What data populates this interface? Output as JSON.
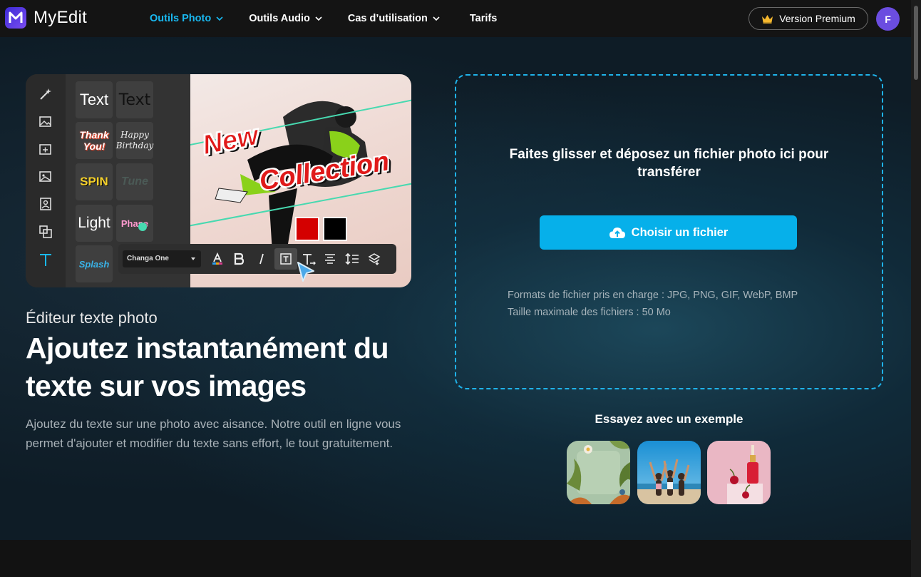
{
  "header": {
    "logo_text": "MyEdit",
    "nav": [
      {
        "label": "Outils Photo",
        "active": true
      },
      {
        "label": "Outils Audio"
      },
      {
        "label": "Cas d’utilisation"
      },
      {
        "label": "Tarifs"
      }
    ],
    "premium_label": "Version Premium",
    "avatar_initial": "F"
  },
  "preview": {
    "tiles": [
      "Text",
      "Text",
      "Thank You!",
      "Happy Birthday",
      "SPIN",
      "Tune",
      "Light",
      "Phase",
      "Splash"
    ],
    "font_select": "Changa One",
    "overlay_line1": "New",
    "overlay_line2": "Collection",
    "swatch_colors": [
      "#d40000",
      "#000000"
    ]
  },
  "hero": {
    "subtitle": "Éditeur texte photo",
    "headline": "Ajoutez instantanément du texte sur vos images",
    "description": "Ajoutez du texte sur une photo avec aisance. Notre outil en ligne vous permet d'ajouter et modifier du texte sans effort, le tout gratuitement."
  },
  "upload": {
    "drop_title": "Faites glisser et déposez un fichier photo ici pour transférer",
    "button_label": "Choisir un fichier",
    "formats": "Formats de fichier pris en charge : JPG, PNG, GIF, WebP, BMP",
    "max_size": "Taille maximale des fichiers : 50 Mo"
  },
  "examples": {
    "label": "Essayez avec un exemple"
  },
  "colors": {
    "accent": "#06b0ea",
    "nav_active": "#19b8f0",
    "brand": "#4b32dc"
  }
}
